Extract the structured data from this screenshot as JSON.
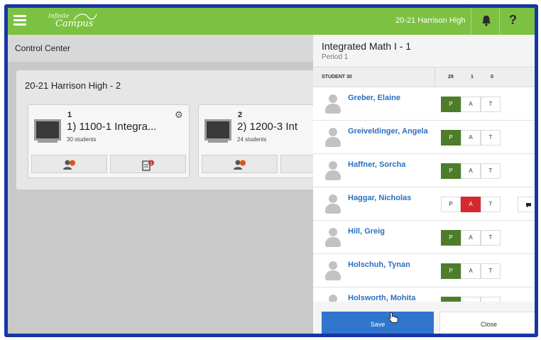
{
  "header": {
    "logo_line1": "Infinite",
    "logo_line2": "Campus",
    "school": "20-21 Harrison High"
  },
  "left": {
    "page_title": "Control Center",
    "section_title": "20-21 Harrison High - 2",
    "cards": [
      {
        "number": "1",
        "name": "1) 1100-1 Integra...",
        "students": "30 students"
      },
      {
        "number": "2",
        "name": "2) 1200-3 Int",
        "students": "24 students"
      }
    ],
    "task_badge": "1"
  },
  "panel": {
    "title": "Integrated Math I - 1",
    "subtitle": "Period 1",
    "student_header": "STUDENT 30",
    "count_p": "29",
    "count_a": "1",
    "count_t": "0",
    "btn_p": "P",
    "btn_a": "A",
    "btn_t": "T",
    "students": [
      {
        "name": "Greber, Elaine",
        "status": "P"
      },
      {
        "name": "Greiveldinger, Angela",
        "status": "P"
      },
      {
        "name": "Haffner, Sorcha",
        "status": "P"
      },
      {
        "name": "Haggar, Nicholas",
        "status": "A"
      },
      {
        "name": "Hill, Greig",
        "status": "P"
      },
      {
        "name": "Holschuh, Tynan",
        "status": "P"
      },
      {
        "name": "Holsworth, Mohita",
        "status": "P"
      }
    ],
    "save_label": "Save",
    "close_label": "Close"
  },
  "colors": {
    "topbar": "#7cc142",
    "present": "#4d7d2a",
    "absent": "#d42a2f",
    "link": "#2c6fbf",
    "save": "#2f76cc",
    "frame": "#1736a6"
  },
  "icons": {
    "menu": "hamburger-icon",
    "notifications": "bell-icon",
    "help": "question-mark-icon",
    "settings": "gear-icon",
    "attendance": "person-alert-icon",
    "tasks": "document-badge-icon",
    "comment": "speech-bubble-icon",
    "avatar": "person-silhouette-icon"
  }
}
